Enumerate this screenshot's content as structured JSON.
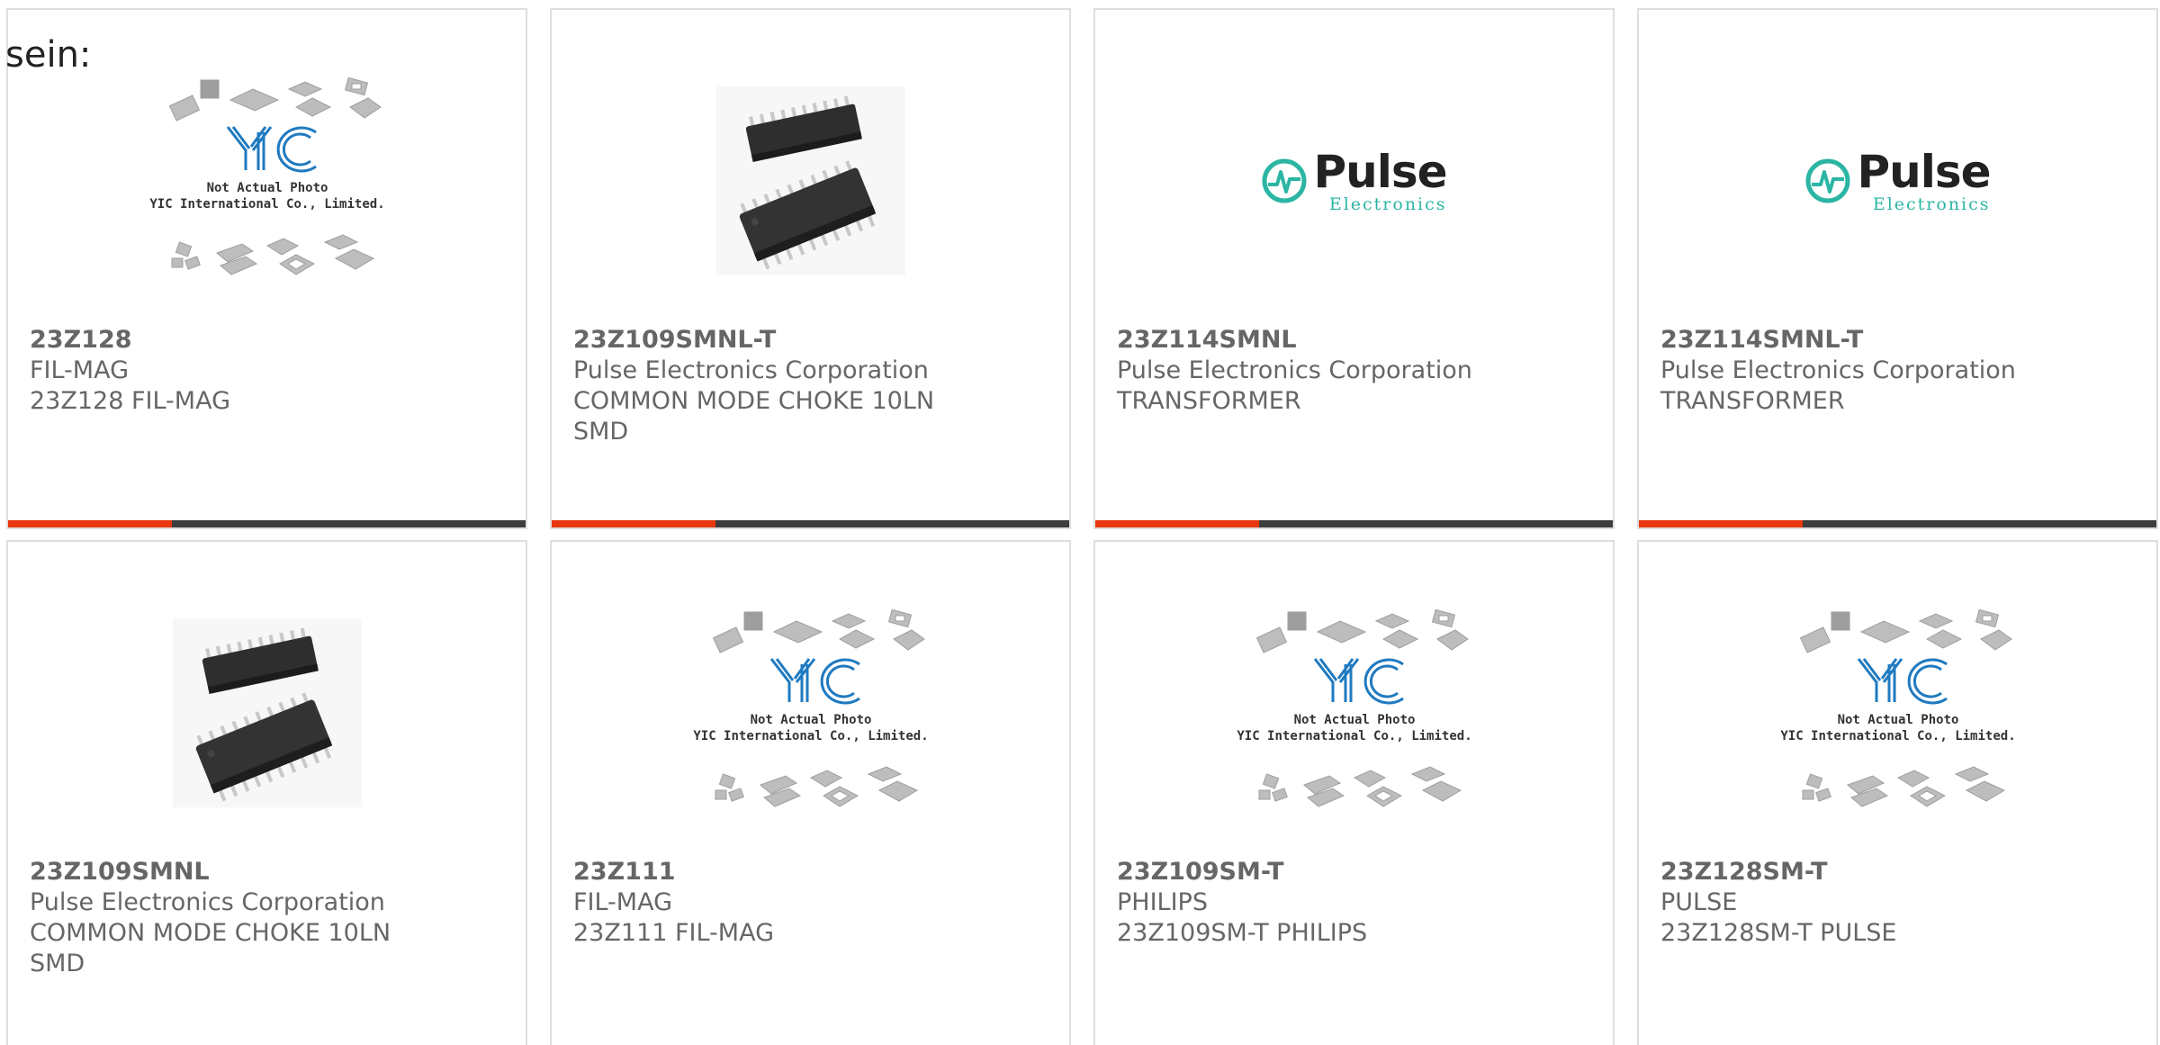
{
  "intro_text": "sein:",
  "placeholder": {
    "line1": "Not Actual Photo",
    "line2": "YIC International Co., Limited."
  },
  "pulse_logo": {
    "word": "Pulse",
    "sub": "Electronics"
  },
  "colors": {
    "accent": "#e8380d",
    "bar": "#3d3d3d",
    "border": "#dedede",
    "text": "#666666",
    "pulse_teal": "#2bb5a3",
    "yic_blue": "#1f7ac0"
  },
  "products": [
    {
      "part": "23Z128",
      "maker": "FIL-MAG",
      "desc": "23Z128 FIL-MAG",
      "image": "yic-placeholder"
    },
    {
      "part": "23Z109SMNL-T",
      "maker": "Pulse Electronics Corporation",
      "desc": "COMMON MODE CHOKE 10LN SMD",
      "image": "soic-chip-photo"
    },
    {
      "part": "23Z114SMNL",
      "maker": "Pulse Electronics Corporation",
      "desc": "TRANSFORMER",
      "image": "pulse-logo"
    },
    {
      "part": "23Z114SMNL-T",
      "maker": "Pulse Electronics Corporation",
      "desc": "TRANSFORMER",
      "image": "pulse-logo"
    },
    {
      "part": "23Z109SMNL",
      "maker": "Pulse Electronics Corporation",
      "desc": "COMMON MODE CHOKE 10LN SMD",
      "image": "soic-chip-photo"
    },
    {
      "part": "23Z111",
      "maker": "FIL-MAG",
      "desc": "23Z111 FIL-MAG",
      "image": "yic-placeholder"
    },
    {
      "part": "23Z109SM-T",
      "maker": "PHILIPS",
      "desc": "23Z109SM-T PHILIPS",
      "image": "yic-placeholder"
    },
    {
      "part": "23Z128SM-T",
      "maker": "PULSE",
      "desc": "23Z128SM-T PULSE",
      "image": "yic-placeholder"
    }
  ]
}
